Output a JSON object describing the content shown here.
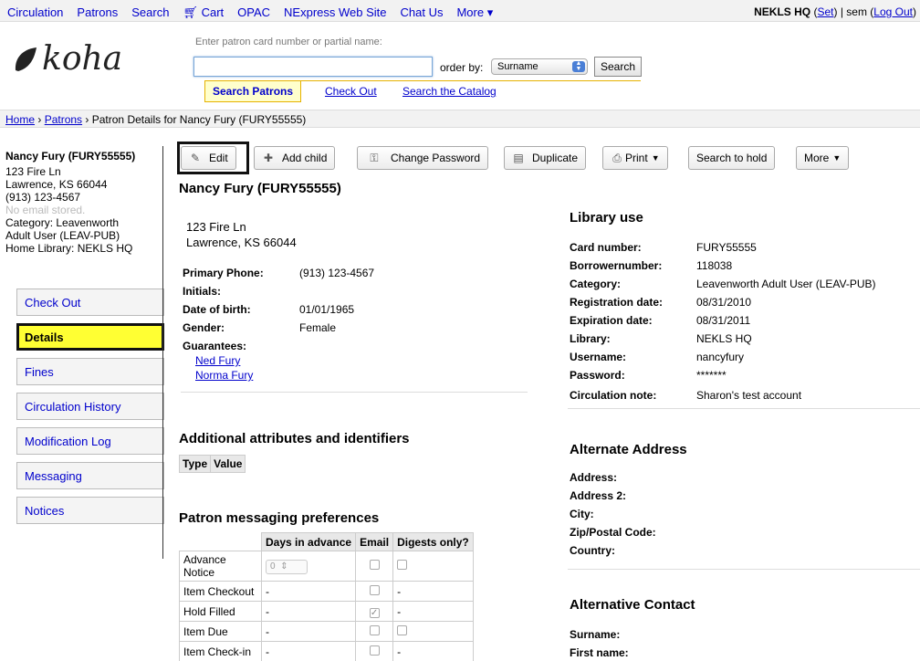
{
  "topnav": {
    "items": [
      "Circulation",
      "Patrons",
      "Search",
      "Cart",
      "OPAC",
      "NExpress Web Site",
      "Chat Us",
      "More"
    ],
    "branch": "NEKLS HQ",
    "set": "Set",
    "user": "| sem (",
    "logout": "Log Out",
    "close_paren": ")"
  },
  "logo": {
    "text": "koha"
  },
  "search": {
    "hint": "Enter patron card number or partial name:",
    "value": "",
    "orderby_label": "order by:",
    "orderby_value": "Surname",
    "button": "Search",
    "tabs": [
      "Search Patrons",
      "Check Out",
      "Search the Catalog"
    ]
  },
  "breadcrumb": {
    "home": "Home",
    "sep": "›",
    "patrons": "Patrons",
    "current": "Patron Details for Nancy Fury (FURY55555)"
  },
  "left": {
    "name": "Nancy Fury (FURY55555)",
    "address1": "123 Fire Ln",
    "address2": "Lawrence, KS 66044",
    "phone": "(913) 123-4567",
    "email": "No email stored.",
    "category1": "Category: Leavenworth",
    "category2": "Adult User (LEAV-PUB)",
    "home_library": "Home Library: NEKLS HQ",
    "tabs": [
      "Check Out",
      "Details",
      "Fines",
      "Circulation History",
      "Modification Log",
      "Messaging",
      "Notices"
    ]
  },
  "toolbar": {
    "edit": "Edit",
    "add_child": "Add child",
    "change_password": "Change Password",
    "duplicate": "Duplicate",
    "print": "Print",
    "search_to_hold": "Search to hold",
    "more": "More"
  },
  "patron": {
    "title": "Nancy Fury (FURY55555)",
    "address1": "123 Fire Ln",
    "address2": "Lawrence, KS 66044",
    "fields": [
      {
        "label": "Primary Phone:",
        "value": "(913) 123-4567"
      },
      {
        "label": "Initials:",
        "value": ""
      },
      {
        "label": "Date of birth:",
        "value": "01/01/1965"
      },
      {
        "label": "Gender:",
        "value": "Female"
      },
      {
        "label": "Guarantees:",
        "value": ""
      }
    ],
    "guarantees": [
      "Ned Fury",
      "Norma Fury"
    ]
  },
  "attributes": {
    "title": "Additional attributes and identifiers",
    "headers": [
      "Type",
      "Value"
    ]
  },
  "messaging": {
    "title": "Patron messaging preferences",
    "headers": [
      "",
      "Days in advance",
      "Email",
      "Digests only?"
    ],
    "rows": [
      {
        "name": "Advance Notice",
        "days": "0",
        "email": false,
        "digest": "box"
      },
      {
        "name": "Item Checkout",
        "days": "-",
        "email": false,
        "digest": "-"
      },
      {
        "name": "Hold Filled",
        "days": "-",
        "email": true,
        "digest": "-"
      },
      {
        "name": "Item Due",
        "days": "-",
        "email": false,
        "digest": "box"
      },
      {
        "name": "Item Check-in",
        "days": "-",
        "email": false,
        "digest": "-"
      }
    ]
  },
  "library_use": {
    "title": "Library use",
    "fields": [
      {
        "label": "Card number:",
        "value": "FURY55555"
      },
      {
        "label": "Borrowernumber:",
        "value": "118038"
      },
      {
        "label": "Category:",
        "value": "Leavenworth Adult User (LEAV-PUB)"
      },
      {
        "label": "Registration date:",
        "value": "08/31/2010"
      },
      {
        "label": "Expiration date:",
        "value": "08/31/2011"
      },
      {
        "label": "Library:",
        "value": "NEKLS HQ"
      },
      {
        "label": "Username:",
        "value": "nancyfury"
      },
      {
        "label": "Password:",
        "value": "*******"
      },
      {
        "label": "Circulation note:",
        "value": "Sharon's test account"
      }
    ]
  },
  "alternate_address": {
    "title": "Alternate Address",
    "fields": [
      "Address:",
      "Address 2:",
      "City:",
      "Zip/Postal Code:",
      "Country:"
    ]
  },
  "alternative_contact": {
    "title": "Alternative Contact",
    "fields": [
      "Surname:",
      "First name:"
    ]
  },
  "colors": {
    "accent": "#ffff33",
    "link": "#0000cc",
    "tab_border": "#e6b200"
  }
}
